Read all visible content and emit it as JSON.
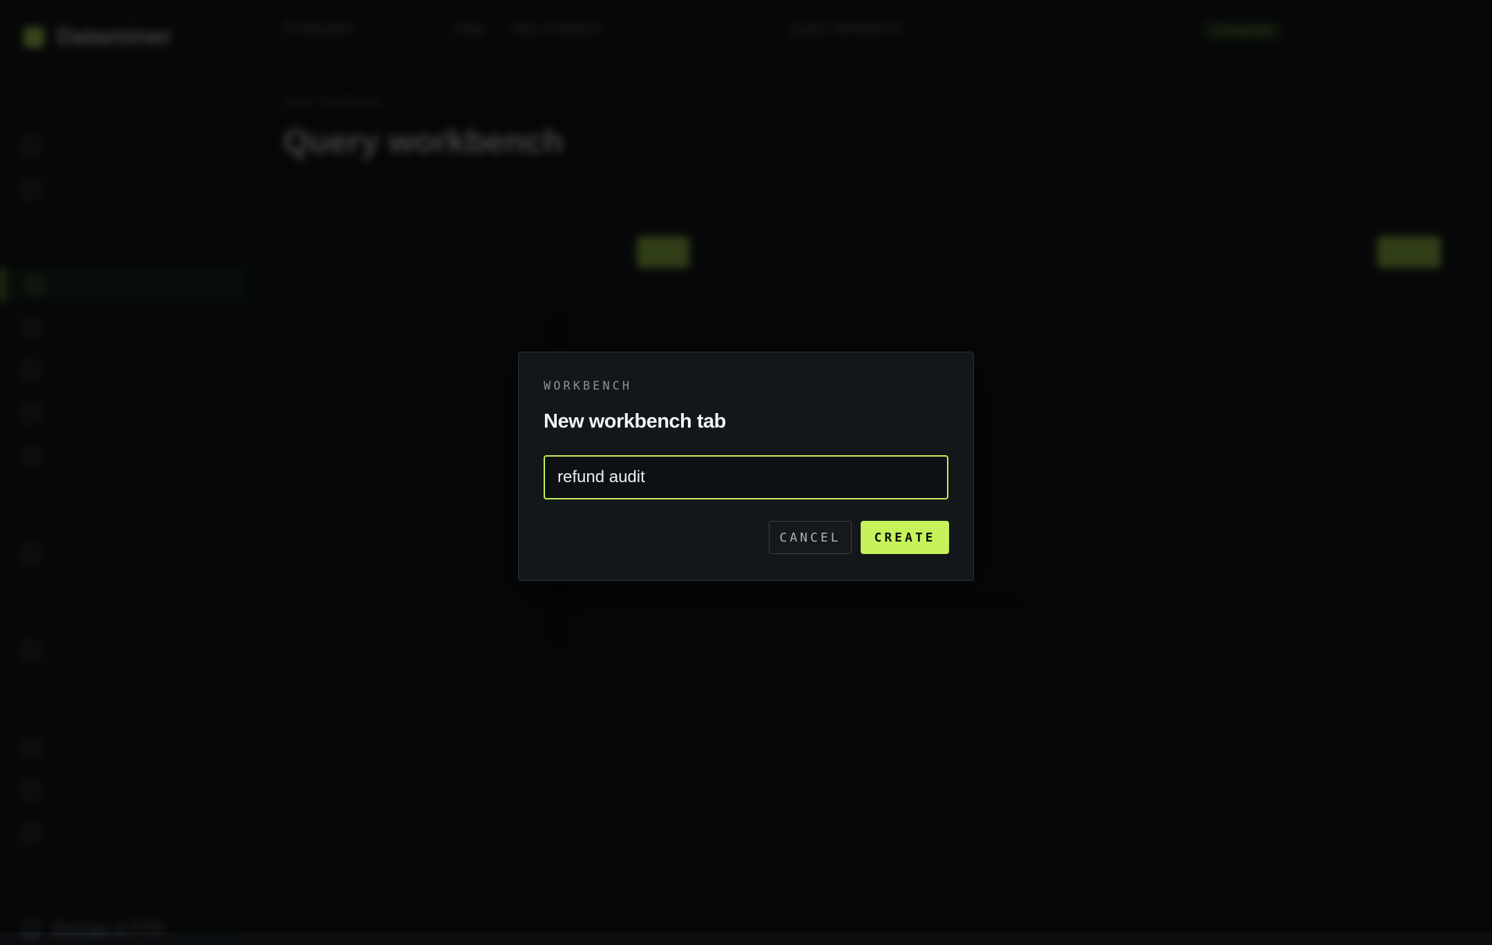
{
  "background_app": {
    "brand": "Dataminer",
    "top": {
      "workspace": "Production",
      "crumb_1": "Data",
      "crumb_2": "SQL Analytics",
      "crumb_3": "Query workbench",
      "status": "Connected"
    },
    "page_breadcrumb": "Data / Workbench",
    "page_title": "Query workbench",
    "sidebar_last_item": "Backups & PITR"
  },
  "dialog": {
    "eyebrow": "WORKBENCH",
    "title": "New workbench tab",
    "input_value": "refund audit",
    "cancel_label": "CANCEL",
    "create_label": "CREATE"
  },
  "colors": {
    "accent": "#c6f35a",
    "background": "#0b0d0f",
    "dialog_bg": "#13171a"
  }
}
